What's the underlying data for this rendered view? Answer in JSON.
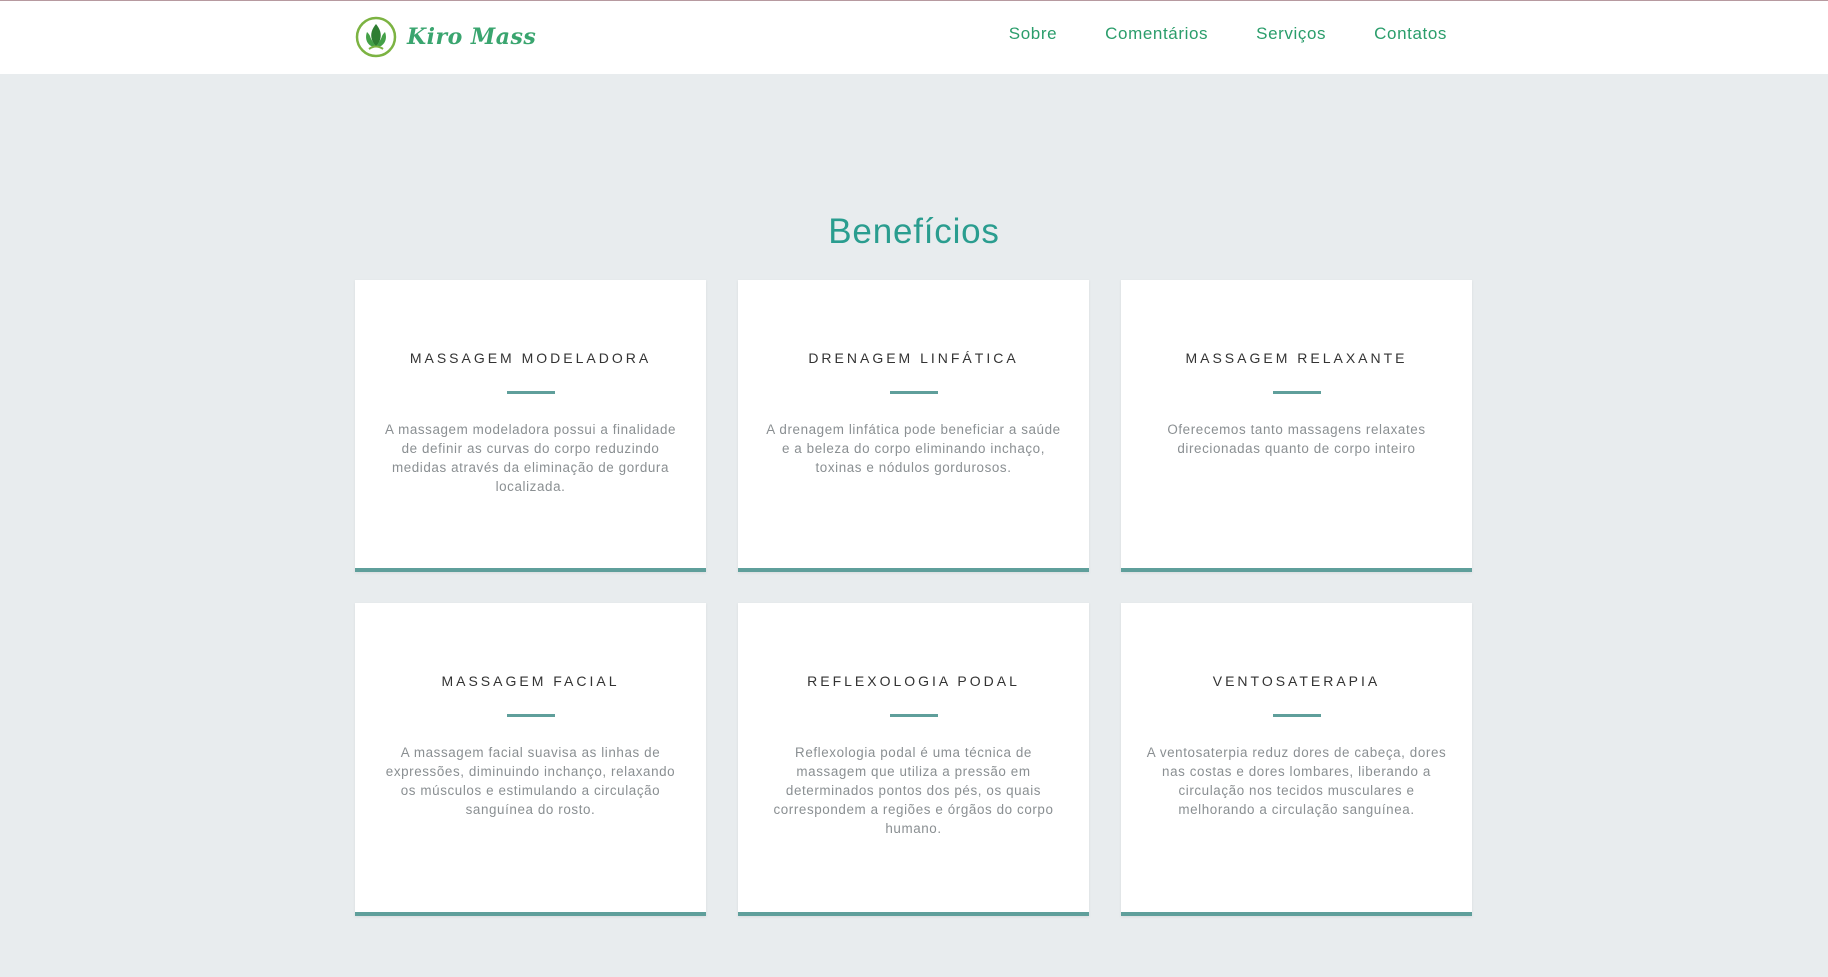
{
  "brand": {
    "name": "Kiro Mass"
  },
  "nav": {
    "items": [
      {
        "label": "Sobre"
      },
      {
        "label": "Comentários"
      },
      {
        "label": "Serviços"
      },
      {
        "label": "Contatos"
      }
    ]
  },
  "benefits": {
    "title": "Benefícios",
    "cards": [
      {
        "title": "MASSAGEM MODELADORA",
        "text": "A massagem modeladora possui a finalidade de definir as curvas do corpo reduzindo medidas através da eliminação de gordura localizada."
      },
      {
        "title": "DRENAGEM LINFÁTICA",
        "text": "A drenagem linfática pode beneficiar a saúde e a beleza do corpo eliminando inchaço, toxinas e nódulos gordurosos."
      },
      {
        "title": "MASSAGEM RELAXANTE",
        "text": "Oferecemos tanto massagens relaxates direcionadas quanto de corpo inteiro"
      },
      {
        "title": "MASSAGEM FACIAL",
        "text": "A massagem facial suavisa as linhas de expressões, diminuindo inchanço, relaxando os músculos e estimulando a circulação sanguínea do rosto."
      },
      {
        "title": "REFLEXOLOGIA PODAL",
        "text": "Reflexologia podal é uma técnica de massagem que utiliza a pressão em determinados pontos dos pés, os quais correspondem a regiões e órgãos do corpo humano."
      },
      {
        "title": "VENTOSATERAPIA",
        "text": "A ventosaterpia reduz dores de cabeça, dores nas costas e dores lombares, liberando a circulação nos tecidos musculares e melhorando a circulação sanguínea."
      }
    ]
  },
  "colors": {
    "accent": "#2a9d8f",
    "nav_link": "#2a9d6b",
    "card_border": "#5f9f9b",
    "page_bg": "#e8ecee"
  },
  "icons": {
    "logo": "leaf-circle-icon"
  }
}
